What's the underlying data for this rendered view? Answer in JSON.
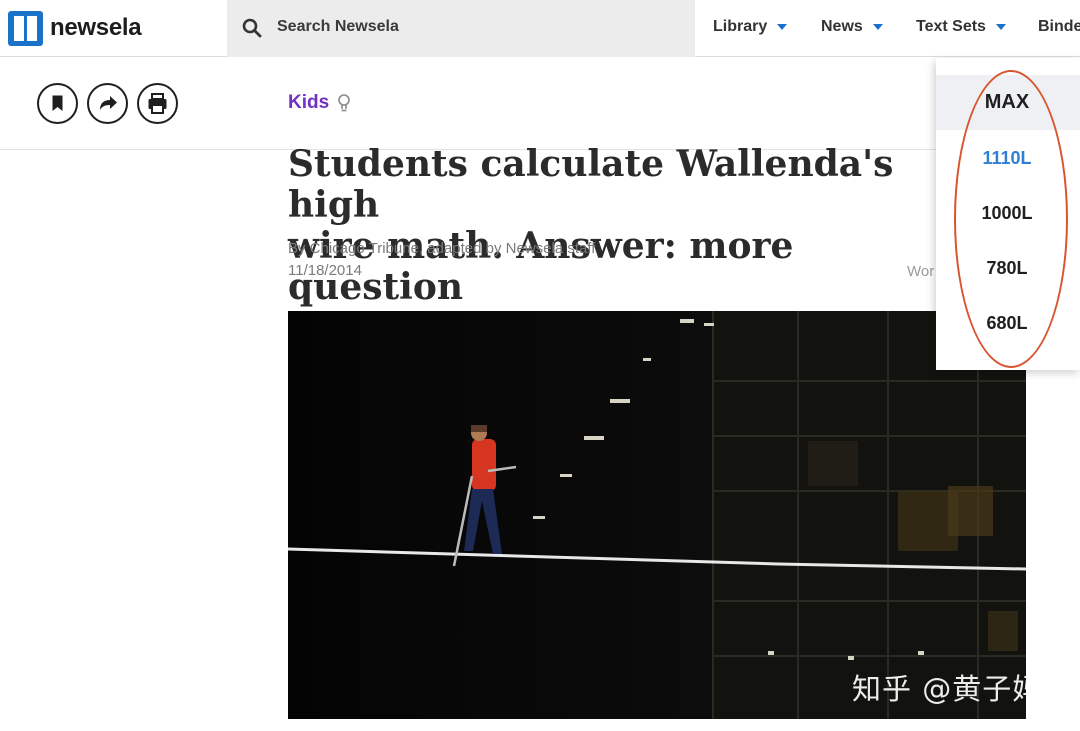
{
  "brand": {
    "name": "newsela",
    "icon": "newsela-logo-icon",
    "color": "#1a73c9"
  },
  "search": {
    "placeholder": "Search Newsela",
    "icon": "search-icon"
  },
  "nav": [
    {
      "label": "Library",
      "icon": "chevron-down-icon"
    },
    {
      "label": "News",
      "icon": "chevron-down-icon"
    },
    {
      "label": "Text Sets",
      "icon": "chevron-down-icon"
    },
    {
      "label": "Binde"
    }
  ],
  "toolbar": {
    "bookmark": "bookmark-icon",
    "share": "share-icon",
    "print": "print-icon"
  },
  "article": {
    "section": "Kids",
    "section_icon": "lightbulb-icon",
    "section_color": "#7132c4",
    "title": "Students calculate Wallenda's high\nwire math. Answer: more question",
    "byline": "By Chicago Tribune, adapted by Newsela staff",
    "date": "11/18/2014",
    "word_label": "Wor",
    "image": "photo of a tightrope walker in a red jacket on a wire at night"
  },
  "reading_levels": {
    "options": [
      "MAX",
      "1110L",
      "1000L",
      "780L",
      "680L"
    ],
    "highlighted": "MAX",
    "selected": "1110L",
    "selected_color": "#2f7fd4",
    "annotation_color": "#d8552e"
  },
  "watermark": "知乎 @黄子妈"
}
